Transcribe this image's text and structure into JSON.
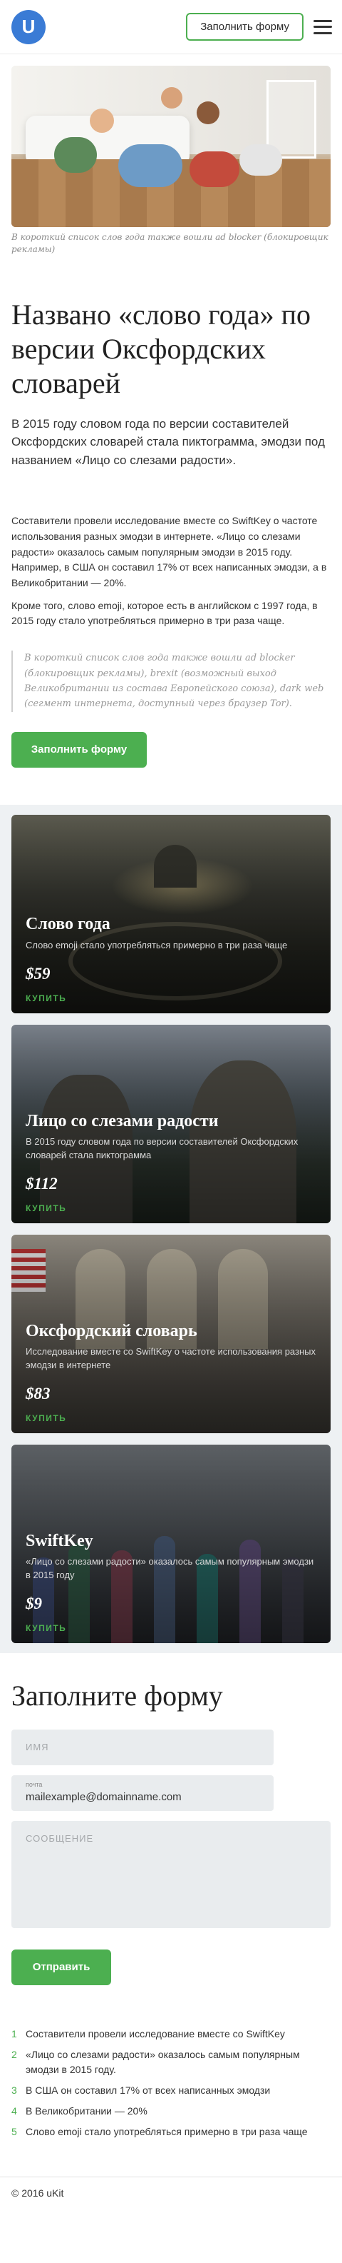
{
  "header": {
    "logo_letter": "U",
    "cta_label": "Заполнить форму"
  },
  "article": {
    "image_caption": "В короткий список слов года также вошли ad blocker (блокировщик рекламы)",
    "title": "Названо «слово года» по версии Оксфордских словарей",
    "lead": "В 2015 году словом года по версии составителей Оксфордских словарей стала пиктограмма, эмодзи под названием «Лицо со слезами радости».",
    "paragraph_1": "Составители провели исследование вместе со SwiftKey о частоте использования разных эмодзи в интернете. «Лицо со слезами радости» оказалось самым популярным эмодзи в 2015 году. Например, в США он составил 17% от всех написанных эмодзи, а в Великобритании — 20%.",
    "paragraph_2": "Кроме того, слово emoji, которое есть в английском с 1997 года, в 2015 году стало употребляться примерно в три раза чаще.",
    "quote": "В короткий список слов года также вошли ad blocker (блокировщик рекламы), brexit (возможный выход Великобритании из состава Европейского союза), dark web (сегмент интернета, доступный через браузер Tor).",
    "button_label": "Заполнить форму"
  },
  "products": [
    {
      "title": "Слово года",
      "description": "Слово emoji стало употребляться примерно в три раза чаще",
      "price": "$59",
      "buy_label": "КУПИТЬ"
    },
    {
      "title": "Лицо со слезами радости",
      "description": "В 2015 году словом года по версии составителей Оксфордских словарей стала пиктограмма",
      "price": "$112",
      "buy_label": "КУПИТЬ"
    },
    {
      "title": "Оксфордский словарь",
      "description": "Исследование вместе со SwiftKey о частоте использования разных эмодзи в интернете",
      "price": "$83",
      "buy_label": "КУПИТЬ"
    },
    {
      "title": "SwiftKey",
      "description": "«Лицо со слезами радости» оказалось самым популярным эмодзи в 2015 году",
      "price": "$9",
      "buy_label": "КУПИТЬ"
    }
  ],
  "form": {
    "title": "Заполните форму",
    "name_placeholder": "ИМЯ",
    "email_label": "почта",
    "email_value": "mailexample@domainname.com",
    "message_placeholder": "СООБЩЕНИЕ",
    "submit_label": "Отправить"
  },
  "list": [
    {
      "num": "1",
      "text": "Составители провели исследование вместе со SwiftKey"
    },
    {
      "num": "2",
      "text": "«Лицо со слезами радости» оказалось самым популярным эмодзи в 2015 году."
    },
    {
      "num": "3",
      "text": "В США он составил 17% от всех написанных эмодзи"
    },
    {
      "num": "4",
      "text": "В Великобритании — 20%"
    },
    {
      "num": "5",
      "text": "Слово emoji стало употребляться примерно в три раза чаще"
    }
  ],
  "footer": {
    "copyright": "© 2016 uKit"
  },
  "colors": {
    "accent_green": "#4caf50",
    "logo_blue": "#3a7bd5"
  }
}
